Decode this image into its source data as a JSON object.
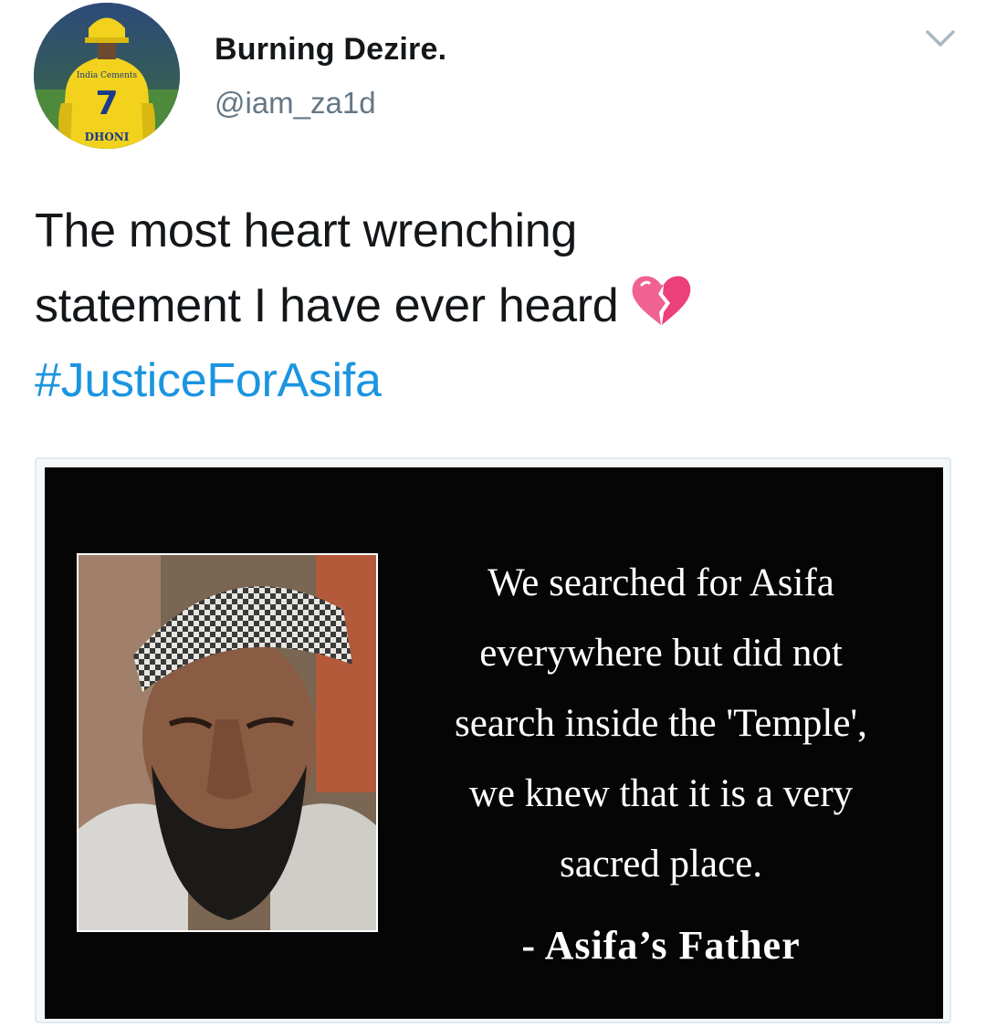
{
  "tweet": {
    "author": {
      "display_name": "Burning Dezire.",
      "handle": "@iam_za1d",
      "avatar_icon": "avatar-cricketer-jersey",
      "avatar_jersey_text": "India Cements",
      "avatar_jersey_number": "7",
      "avatar_jersey_name": "DHONI"
    },
    "menu_icon": "chevron-down-icon",
    "text": {
      "line1": "The most heart wrenching",
      "line2": "statement I have ever heard",
      "emoji": "broken-heart-icon",
      "hashtag": "#JusticeForAsifa"
    },
    "media": {
      "quote_lines": [
        "We searched for Asifa",
        "everywhere but did not",
        "search inside the 'Temple',",
        "we knew that it is a very",
        "sacred place."
      ],
      "attribution": "- Asifa’s Father"
    }
  },
  "colors": {
    "text_primary": "#14171a",
    "text_secondary": "#657786",
    "hashtag": "#1b95e0",
    "media_background": "#050505",
    "chevron": "#aab8c2"
  }
}
